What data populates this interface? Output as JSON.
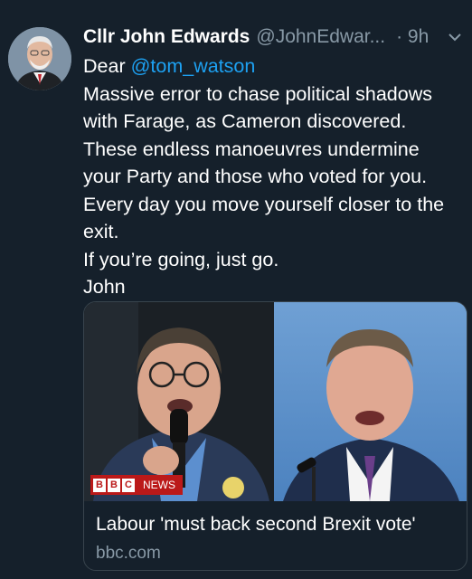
{
  "tweet": {
    "author_name": "Cllr John Edwards",
    "handle": "@JohnEdwar...",
    "time": "· 9h",
    "lines": [
      {
        "prefix": "Dear ",
        "mention": "@tom_watson"
      },
      "Massive error to chase political shadows",
      "with Farage, as Cameron discovered.",
      "These endless manoeuvres undermine",
      "your Party and those who voted for you.",
      "Every day you move yourself closer to the",
      "exit.",
      "If you’re going, just go.",
      "John"
    ]
  },
  "card": {
    "badge_bbc": [
      "B",
      "B",
      "C"
    ],
    "badge_news": "NEWS",
    "title": "Labour 'must back second Brexit vote'",
    "domain": "bbc.com"
  },
  "colors": {
    "background": "#15202b",
    "text": "#ffffff",
    "muted": "#8899a6",
    "link": "#1da1f2",
    "border": "#38444d",
    "bbc_red": "#bb1919"
  },
  "icons": [
    "chevron-down-icon",
    "avatar"
  ]
}
